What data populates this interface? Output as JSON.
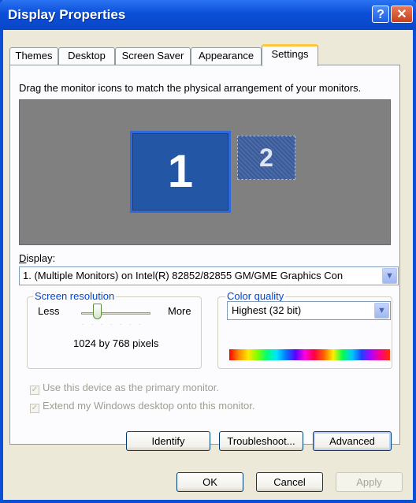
{
  "window": {
    "title": "Display Properties",
    "help_glyph": "?",
    "close_glyph": "✕"
  },
  "tabs": [
    {
      "label": "Themes"
    },
    {
      "label": "Desktop"
    },
    {
      "label": "Screen Saver"
    },
    {
      "label": "Appearance"
    },
    {
      "label": "Settings",
      "active": true
    }
  ],
  "settings": {
    "instruction": "Drag the monitor icons to match the physical arrangement of your monitors.",
    "monitors": [
      {
        "number": "1",
        "selected": true
      },
      {
        "number": "2",
        "selected": false
      }
    ],
    "display_label": "Display:",
    "display_value": "1. (Multiple Monitors) on Intel(R) 82852/82855 GM/GME Graphics Con",
    "resolution": {
      "title": "Screen resolution",
      "less": "Less",
      "more": "More",
      "value": "1024 by 768 pixels",
      "slider_level": 0.2
    },
    "color_quality": {
      "title": "Color quality",
      "value": "Highest (32 bit)"
    },
    "checkboxes": [
      {
        "label": "Use this device as the primary monitor.",
        "checked": true,
        "enabled": false
      },
      {
        "label": "Extend my Windows desktop onto this monitor.",
        "checked": true,
        "enabled": false
      }
    ],
    "buttons": {
      "identify": "Identify",
      "troubleshoot": "Troubleshoot...",
      "advanced": "Advanced"
    }
  },
  "footer": {
    "ok": "OK",
    "cancel": "Cancel",
    "apply": "Apply"
  },
  "colors": {
    "titlebar": "#0a4fd6",
    "dialog": "#ece9d8",
    "monitor_bg": "#808080",
    "monitor_selected": "#2456a6",
    "group_title": "#0046d5"
  }
}
